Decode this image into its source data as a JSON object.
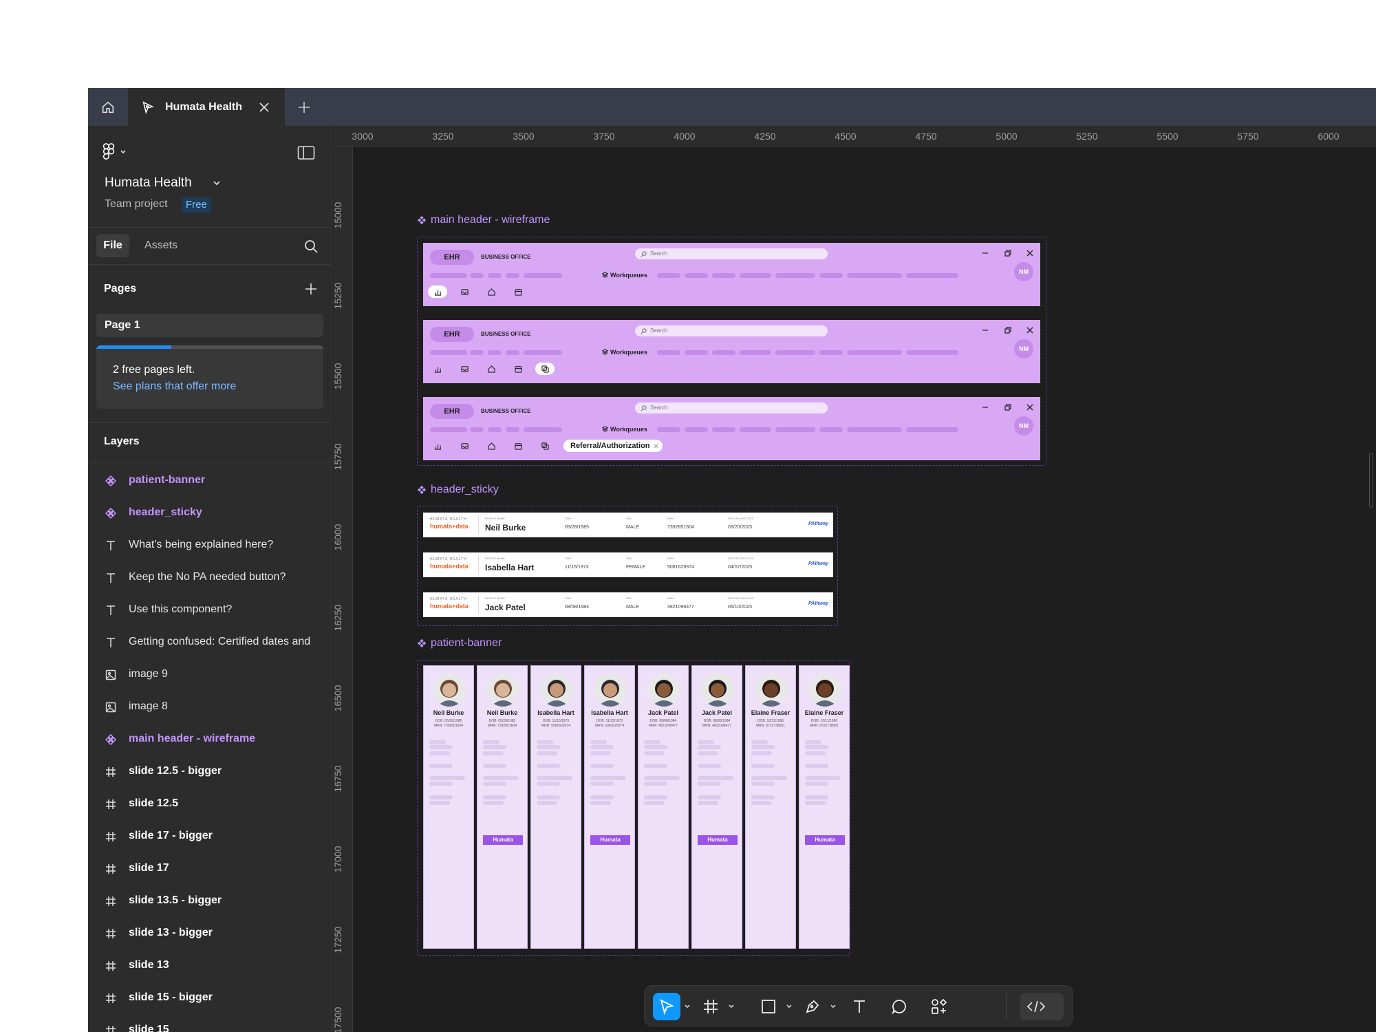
{
  "tabbar": {
    "file_tab_label": "Humata Health"
  },
  "sidebar": {
    "project_name": "Humata Health",
    "project_sub": "Team project",
    "plan_badge": "Free",
    "tab_file": "File",
    "tab_assets": "Assets",
    "pages_heading": "Pages",
    "page_item": "Page 1",
    "upgrade_text": "2 free pages left.",
    "upgrade_link": "See plans that offer more",
    "pages_used_fraction": 0.33,
    "layers_heading": "Layers",
    "layers": [
      {
        "label": "patient-banner",
        "type": "component"
      },
      {
        "label": "header_sticky",
        "type": "component"
      },
      {
        "label": "What's being explained here?",
        "type": "text"
      },
      {
        "label": "Keep the No PA needed button?",
        "type": "text"
      },
      {
        "label": "Use this component?",
        "type": "text"
      },
      {
        "label": "Getting confused: Certified dates and",
        "type": "text"
      },
      {
        "label": "image 9",
        "type": "image"
      },
      {
        "label": "image 8",
        "type": "image"
      },
      {
        "label": "main header - wireframe",
        "type": "component"
      },
      {
        "label": "slide 12.5 - bigger",
        "type": "frame"
      },
      {
        "label": "slide 12.5",
        "type": "frame"
      },
      {
        "label": "slide 17 - bigger",
        "type": "frame"
      },
      {
        "label": "slide 17",
        "type": "frame"
      },
      {
        "label": "slide 13.5 - bigger",
        "type": "frame"
      },
      {
        "label": "slide 13 - bigger",
        "type": "frame"
      },
      {
        "label": "slide 13",
        "type": "frame"
      },
      {
        "label": "slide 15 - bigger",
        "type": "frame"
      },
      {
        "label": "slide 15",
        "type": "frame"
      }
    ]
  },
  "rulers": {
    "top": [
      "3000",
      "3250",
      "3500",
      "3750",
      "4000",
      "4250",
      "4500",
      "4750",
      "5000",
      "5250",
      "5500",
      "5750",
      "6000"
    ],
    "left": [
      "15000",
      "15250",
      "15500",
      "15750",
      "16000",
      "16250",
      "16500",
      "16750",
      "17000",
      "17250",
      "17500"
    ]
  },
  "canvas": {
    "frame_labels": {
      "main_header": "main header - wireframe",
      "header_sticky": "header_sticky",
      "patient_banner": "patient-banner"
    },
    "main_header": {
      "ehr": "EHR",
      "business_office": "BUSINESS OFFICE",
      "search_placeholder": "Search",
      "workqueues": "Workqueues",
      "avatar_initials": "NM",
      "referral_chip": "Referral/Authorization"
    },
    "sticky": {
      "logo_top": "HUMATA HEALTH",
      "logo_main": "humata+data",
      "patient_name_label": "PATIENT NAME",
      "dob_label": "DOB:",
      "sex_label": "SEX:",
      "mrn_label": "MRN:",
      "procedure_label": "PROCEDURE DATE:",
      "brand": "PAthway",
      "rows": [
        {
          "name": "Neil Burke",
          "dob": "05/28/1985",
          "sex": "MALE",
          "mrn": "7392851604",
          "procedure": "03/20/2025"
        },
        {
          "name": "Isabella Hart",
          "dob": "11/15/1973",
          "sex": "FEMALE",
          "mrn": "5081629374",
          "procedure": "04/07/2025"
        },
        {
          "name": "Jack Patel",
          "dob": "08/08/1984",
          "sex": "MALE",
          "mrn": "4821096477",
          "procedure": "06/10/2025"
        }
      ]
    },
    "patient_banner": {
      "button_label": "Humata",
      "cards": [
        {
          "name": "Neil Burke",
          "dob": "DOB: 05/28/1985",
          "mrn": "MRN: 7392851604",
          "button": false,
          "skin": "#d9b59a",
          "hair": "#6b4a32"
        },
        {
          "name": "Neil Burke",
          "dob": "DOB: 05/28/1985",
          "mrn": "MRN: 7392851604",
          "button": true,
          "skin": "#d9b59a",
          "hair": "#6b4a32"
        },
        {
          "name": "Isabella Hart",
          "dob": "DOB: 11/15/1973",
          "mrn": "MRN: 5081629374",
          "button": false,
          "skin": "#c99a7a",
          "hair": "#2a2a2a"
        },
        {
          "name": "Isabella Hart",
          "dob": "DOB: 11/15/1973",
          "mrn": "MRN: 5081629374",
          "button": true,
          "skin": "#c99a7a",
          "hair": "#2a2a2a"
        },
        {
          "name": "Jack Patel",
          "dob": "DOB: 08/08/1984",
          "mrn": "MRN: 4821096477",
          "button": false,
          "skin": "#8a5a3a",
          "hair": "#1a1a1a"
        },
        {
          "name": "Jack Patel",
          "dob": "DOB: 08/08/1984",
          "mrn": "MRN: 4821096477",
          "button": true,
          "skin": "#8a5a3a",
          "hair": "#1a1a1a"
        },
        {
          "name": "Elaine Fraser",
          "dob": "DOB: 12/11/1990",
          "mrn": "MRN: 8722738051",
          "button": false,
          "skin": "#6b3f28",
          "hair": "#2a1a12"
        },
        {
          "name": "Elaine Fraser",
          "dob": "DOB: 12/11/1990",
          "mrn": "MRN: 8722738051",
          "button": true,
          "skin": "#6b3f28",
          "hair": "#2a1a12"
        }
      ]
    }
  },
  "colors": {
    "accent": "#0d99ff",
    "component": "#c194ff",
    "header_fill": "#d8a8f5",
    "button_purple": "#9b54e8"
  }
}
